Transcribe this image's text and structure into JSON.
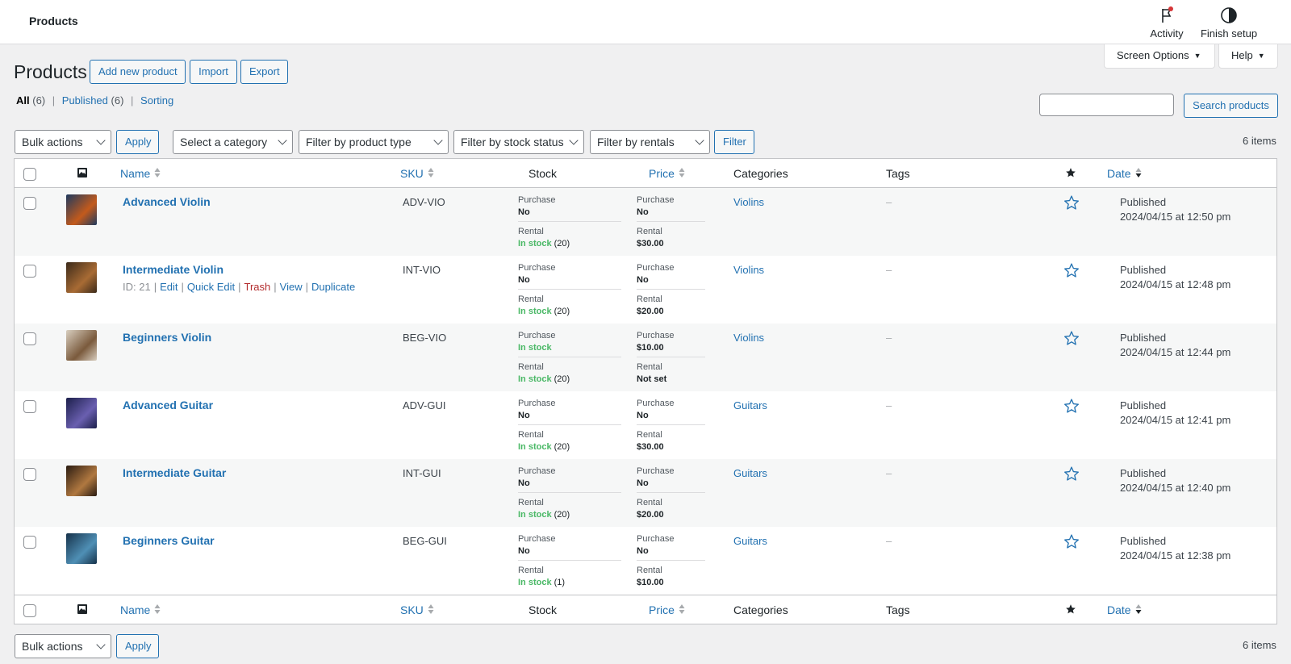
{
  "header": {
    "title": "Products",
    "actions": [
      {
        "label": "Activity",
        "icon": "flag-icon"
      },
      {
        "label": "Finish setup",
        "icon": "half-circle-icon"
      }
    ]
  },
  "tabs": {
    "screen_options": "Screen Options",
    "help": "Help"
  },
  "page": {
    "title": "Products",
    "buttons": {
      "add_new": "Add new product",
      "import": "Import",
      "export": "Export"
    }
  },
  "views": {
    "all_label": "All",
    "all_count": "(6)",
    "published_label": "Published",
    "published_count": "(6)",
    "sorting_label": "Sorting",
    "separator": "|"
  },
  "search": {
    "value": "",
    "button": "Search products"
  },
  "filters": {
    "bulk_actions": "Bulk actions",
    "apply": "Apply",
    "category": "Select a category",
    "product_type": "Filter by product type",
    "stock_status": "Filter by stock status",
    "rentals": "Filter by rentals",
    "filter_button": "Filter",
    "items_count": "6 items"
  },
  "columns": {
    "name": "Name",
    "sku": "SKU",
    "stock": "Stock",
    "price": "Price",
    "categories": "Categories",
    "tags": "Tags",
    "date": "Date"
  },
  "mini_labels": {
    "purchase": "Purchase",
    "rental": "Rental"
  },
  "products": [
    {
      "name": "Advanced Violin",
      "sku": "ADV-VIO",
      "stock_purchase": "No",
      "stock_rental": "In stock",
      "stock_rental_qty": "(20)",
      "stock_purchase_in": false,
      "price_purchase": "No",
      "price_rental": "$30.00",
      "category": "Violins",
      "tags": "–",
      "status": "Published",
      "date": "2024/04/15 at 12:50 pm",
      "thumb_colors": [
        "#1e3a5f",
        "#c35a1c"
      ]
    },
    {
      "name": "Intermediate Violin",
      "sku": "INT-VIO",
      "stock_purchase": "No",
      "stock_rental": "In stock",
      "stock_rental_qty": "(20)",
      "stock_purchase_in": false,
      "price_purchase": "No",
      "price_rental": "$20.00",
      "category": "Violins",
      "tags": "–",
      "status": "Published",
      "date": "2024/04/15 at 12:48 pm",
      "thumb_colors": [
        "#3b2a1a",
        "#a86b34"
      ],
      "row_actions": {
        "id": "ID: 21",
        "edit": "Edit",
        "quick_edit": "Quick Edit",
        "trash": "Trash",
        "view": "View",
        "duplicate": "Duplicate"
      }
    },
    {
      "name": "Beginners Violin",
      "sku": "BEG-VIO",
      "stock_purchase": "In stock",
      "stock_rental": "In stock",
      "stock_rental_qty": "(20)",
      "stock_purchase_in": true,
      "price_purchase": "$10.00",
      "price_rental": "Not set",
      "category": "Violins",
      "tags": "–",
      "status": "Published",
      "date": "2024/04/15 at 12:44 pm",
      "thumb_colors": [
        "#d9cfc0",
        "#7a5a3c"
      ]
    },
    {
      "name": "Advanced Guitar",
      "sku": "ADV-GUI",
      "stock_purchase": "No",
      "stock_rental": "In stock",
      "stock_rental_qty": "(20)",
      "stock_purchase_in": false,
      "price_purchase": "No",
      "price_rental": "$30.00",
      "category": "Guitars",
      "tags": "–",
      "status": "Published",
      "date": "2024/04/15 at 12:41 pm",
      "thumb_colors": [
        "#1c1f4a",
        "#6a5fb0"
      ]
    },
    {
      "name": "Intermediate Guitar",
      "sku": "INT-GUI",
      "stock_purchase": "No",
      "stock_rental": "In stock",
      "stock_rental_qty": "(20)",
      "stock_purchase_in": false,
      "price_purchase": "No",
      "price_rental": "$20.00",
      "category": "Guitars",
      "tags": "–",
      "status": "Published",
      "date": "2024/04/15 at 12:40 pm",
      "thumb_colors": [
        "#2a1c12",
        "#b07840"
      ]
    },
    {
      "name": "Beginners Guitar",
      "sku": "BEG-GUI",
      "stock_purchase": "No",
      "stock_rental": "In stock",
      "stock_rental_qty": "(1)",
      "stock_purchase_in": false,
      "price_purchase": "No",
      "price_rental": "$10.00",
      "category": "Guitars",
      "tags": "–",
      "status": "Published",
      "date": "2024/04/15 at 12:38 pm",
      "thumb_colors": [
        "#16324a",
        "#4f8fb5"
      ]
    }
  ],
  "colors": {
    "link": "#2271b1",
    "in_stock": "#4ab866",
    "trash": "#b32d2e",
    "notification_dot": "#d63638"
  }
}
